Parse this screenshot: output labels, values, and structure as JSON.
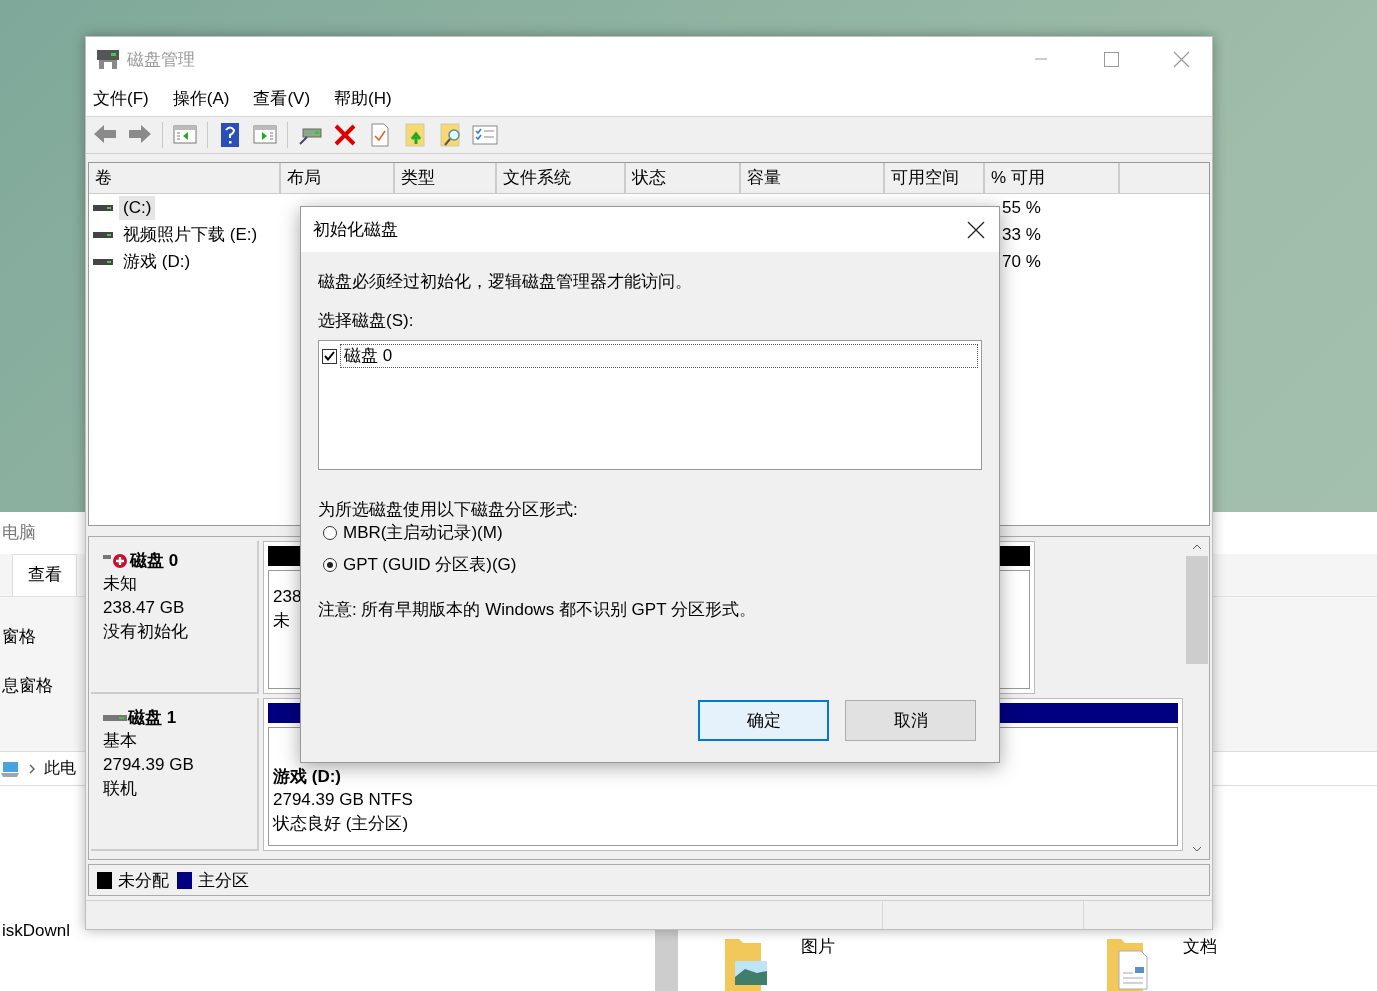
{
  "explorer": {
    "title": "电脑",
    "tab": "查看",
    "pane_items": [
      "窗格",
      "息窗格"
    ],
    "breadcrumb": "此电",
    "nav_item": "iskDownl",
    "folders": [
      {
        "name": "图片",
        "kind": "pictures"
      },
      {
        "name": "文档",
        "kind": "documents"
      }
    ]
  },
  "window": {
    "title": "磁盘管理",
    "menu": [
      "文件(F)",
      "操作(A)",
      "查看(V)",
      "帮助(H)"
    ]
  },
  "table": {
    "columns": [
      "卷",
      "布局",
      "类型",
      "文件系统",
      "状态",
      "容量",
      "可用空间",
      "% 可用"
    ],
    "rows": [
      {
        "volume": "(C:)",
        "selected": true,
        "percent_free": "55 %"
      },
      {
        "volume": "视频照片下载 (E:)",
        "selected": false,
        "percent_free": "33 %"
      },
      {
        "volume": "游戏 (D:)",
        "selected": false,
        "percent_free": "70 %"
      }
    ]
  },
  "disks": [
    {
      "name": "磁盘 0",
      "kind": "uninitialized",
      "type": "未知",
      "size": "238.47 GB",
      "state": "没有初始化",
      "partition": {
        "kind": "unallocated",
        "lines": [
          "238",
          "未"
        ]
      }
    },
    {
      "name": "磁盘 1",
      "kind": "online",
      "type": "基本",
      "size": "2794.39 GB",
      "state": "联机",
      "partition": {
        "kind": "primary",
        "name": "游戏 (D:)",
        "lines": [
          "2794.39 GB NTFS",
          "状态良好 (主分区)"
        ]
      }
    }
  ],
  "legend": [
    {
      "label": "未分配",
      "color": "#000000"
    },
    {
      "label": "主分区",
      "color": "#000080"
    }
  ],
  "dialog": {
    "title": "初始化磁盘",
    "message": "磁盘必须经过初始化，逻辑磁盘管理器才能访问。",
    "select_label": "选择磁盘(S):",
    "disks": [
      {
        "label": "磁盘 0",
        "checked": true
      }
    ],
    "style_label": "为所选磁盘使用以下磁盘分区形式:",
    "options": [
      {
        "label": "MBR(主启动记录)(M)",
        "selected": false
      },
      {
        "label": "GPT (GUID 分区表)(G)",
        "selected": true
      }
    ],
    "note": "注意: 所有早期版本的 Windows 都不识别 GPT 分区形式。",
    "buttons": [
      {
        "label": "确定",
        "default": true
      },
      {
        "label": "取消",
        "default": false
      }
    ]
  }
}
